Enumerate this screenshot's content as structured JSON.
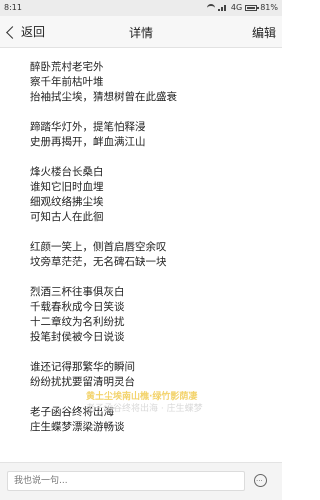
{
  "status_bar": {
    "time": "8:11",
    "network": "4G",
    "battery": "81%",
    "battery_level": 0.81
  },
  "nav": {
    "back_label": "返回",
    "title": "详情",
    "edit_label": "编辑"
  },
  "poem": {
    "stanzas": [
      [
        "醉卧荒村老宅外",
        "察千年前枯叶堆",
        "抬袖拭尘埃，猜想树曾在此盛衰"
      ],
      [
        "蹄踏华灯外，提笔怕释浸",
        "史册再揭开，衅血满江山"
      ],
      [
        "烽火楼台长桑白",
        "谁知它旧时血埋",
        "细观纹络拂尘埃",
        "可知古人在此徊"
      ],
      [
        "红颜一笑上，侧首启唇空余叹",
        "坟旁草茫茫，无名碑石缺一块"
      ],
      [
        "烈酒三杯往事俱灰白",
        "千载春秋成今日笑谈",
        "十二章纹为名利纷扰",
        "投笔封侯被今日说谈"
      ],
      [
        "谁还记得那繁华的瞬间",
        "纷纷扰扰要留清明灵台"
      ],
      [
        "老子函谷终将出海",
        "庄生蝶梦漂梁游畅谈"
      ]
    ]
  },
  "watermark": {
    "line1": "黄土尘埃南山樵·绿竹影荫凄",
    "line2": "老子函谷终将出海 · 庄生蝶梦"
  },
  "comment": {
    "placeholder": "我也说一句..."
  },
  "icons": {
    "back": "chevron-left-icon",
    "send": "comment-icon"
  }
}
